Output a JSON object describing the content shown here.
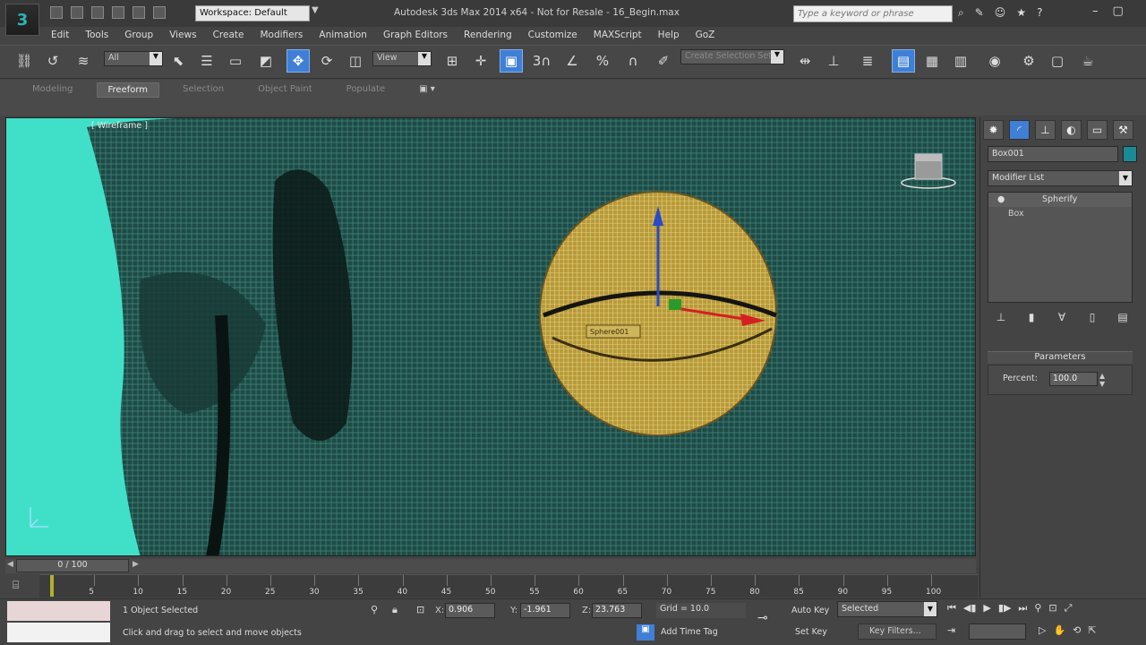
{
  "titlebar": {
    "workspace": "Workspace: Default",
    "title": "Autodesk 3ds Max 2014 x64 - Not for Resale - 16_Begin.max",
    "search_placeholder": "Type a keyword or phrase"
  },
  "menu": [
    "Edit",
    "Tools",
    "Group",
    "Views",
    "Create",
    "Modifiers",
    "Animation",
    "Graph Editors",
    "Rendering",
    "Customize",
    "MAXScript",
    "Help",
    "GoZ"
  ],
  "toolbar": {
    "selection_filter": "All",
    "ref_coord": "View",
    "named_selection": "Create Selection Set",
    "snap_label": "3"
  },
  "ribbon": {
    "tabs": [
      "Modeling",
      "Freeform",
      "Selection",
      "Object Paint",
      "Populate"
    ],
    "active_tab": "Freeform"
  },
  "viewport": {
    "label": "[ Wireframe ]",
    "object_tag": "Sphere001",
    "bg_color": "#40e0c8"
  },
  "command_panel": {
    "object_name": "Box001",
    "object_color": "#1a8a94",
    "modifier_list": "Modifier List",
    "stack": [
      "Spherify",
      "Box"
    ],
    "rollout_title": "Parameters",
    "param_label": "Percent:",
    "param_value": "100.0"
  },
  "timeline": {
    "slider_text": "0 / 100",
    "ticks": [
      "5",
      "10",
      "15",
      "20",
      "25",
      "30",
      "35",
      "40",
      "45",
      "50",
      "55",
      "60",
      "65",
      "70",
      "75",
      "80",
      "85",
      "90",
      "95",
      "100"
    ]
  },
  "status": {
    "selection": "1 Object Selected",
    "prompt": "Click and drag to select and move objects",
    "x": "0.906",
    "y": "-1.961",
    "z": "23.763",
    "grid": "Grid = 10.0",
    "add_time_tag": "Add Time Tag",
    "auto_key": "Auto Key",
    "set_key": "Set Key",
    "selected": "Selected",
    "key_filters": "Key Filters..."
  }
}
